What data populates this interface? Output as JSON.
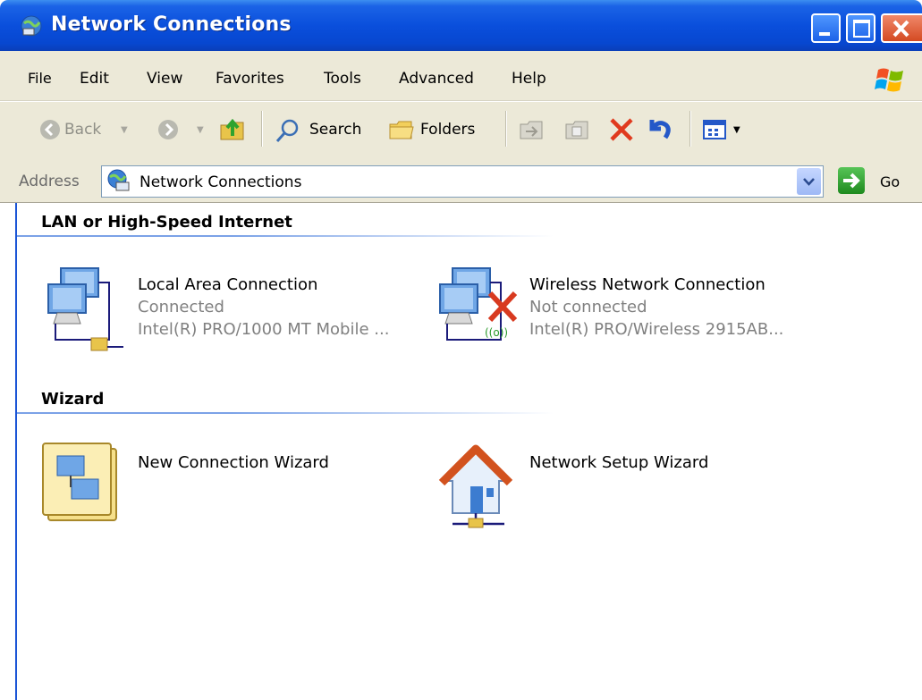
{
  "window": {
    "title": "Network Connections"
  },
  "menu": [
    "File",
    "Edit",
    "View",
    "Favorites",
    "Tools",
    "Advanced",
    "Help"
  ],
  "toolbar": {
    "back": "Back",
    "search": "Search",
    "folders": "Folders"
  },
  "address": {
    "label": "Address",
    "value": "Network Connections",
    "go": "Go"
  },
  "sections": [
    {
      "title": "LAN or High-Speed Internet",
      "items": [
        {
          "name": "Local Area Connection",
          "status": "Connected",
          "device": "Intel(R) PRO/1000 MT Mobile ..."
        },
        {
          "name": "Wireless Network Connection",
          "status": "Not connected",
          "device": "Intel(R) PRO/Wireless 2915AB..."
        }
      ]
    },
    {
      "title": "Wizard",
      "items": [
        {
          "name": "New Connection Wizard"
        },
        {
          "name": "Network Setup Wizard"
        }
      ]
    }
  ],
  "colors": {
    "titlebar": "#0a4fdc",
    "chrome": "#ece9d8",
    "section_line": "#7ba2e7"
  }
}
